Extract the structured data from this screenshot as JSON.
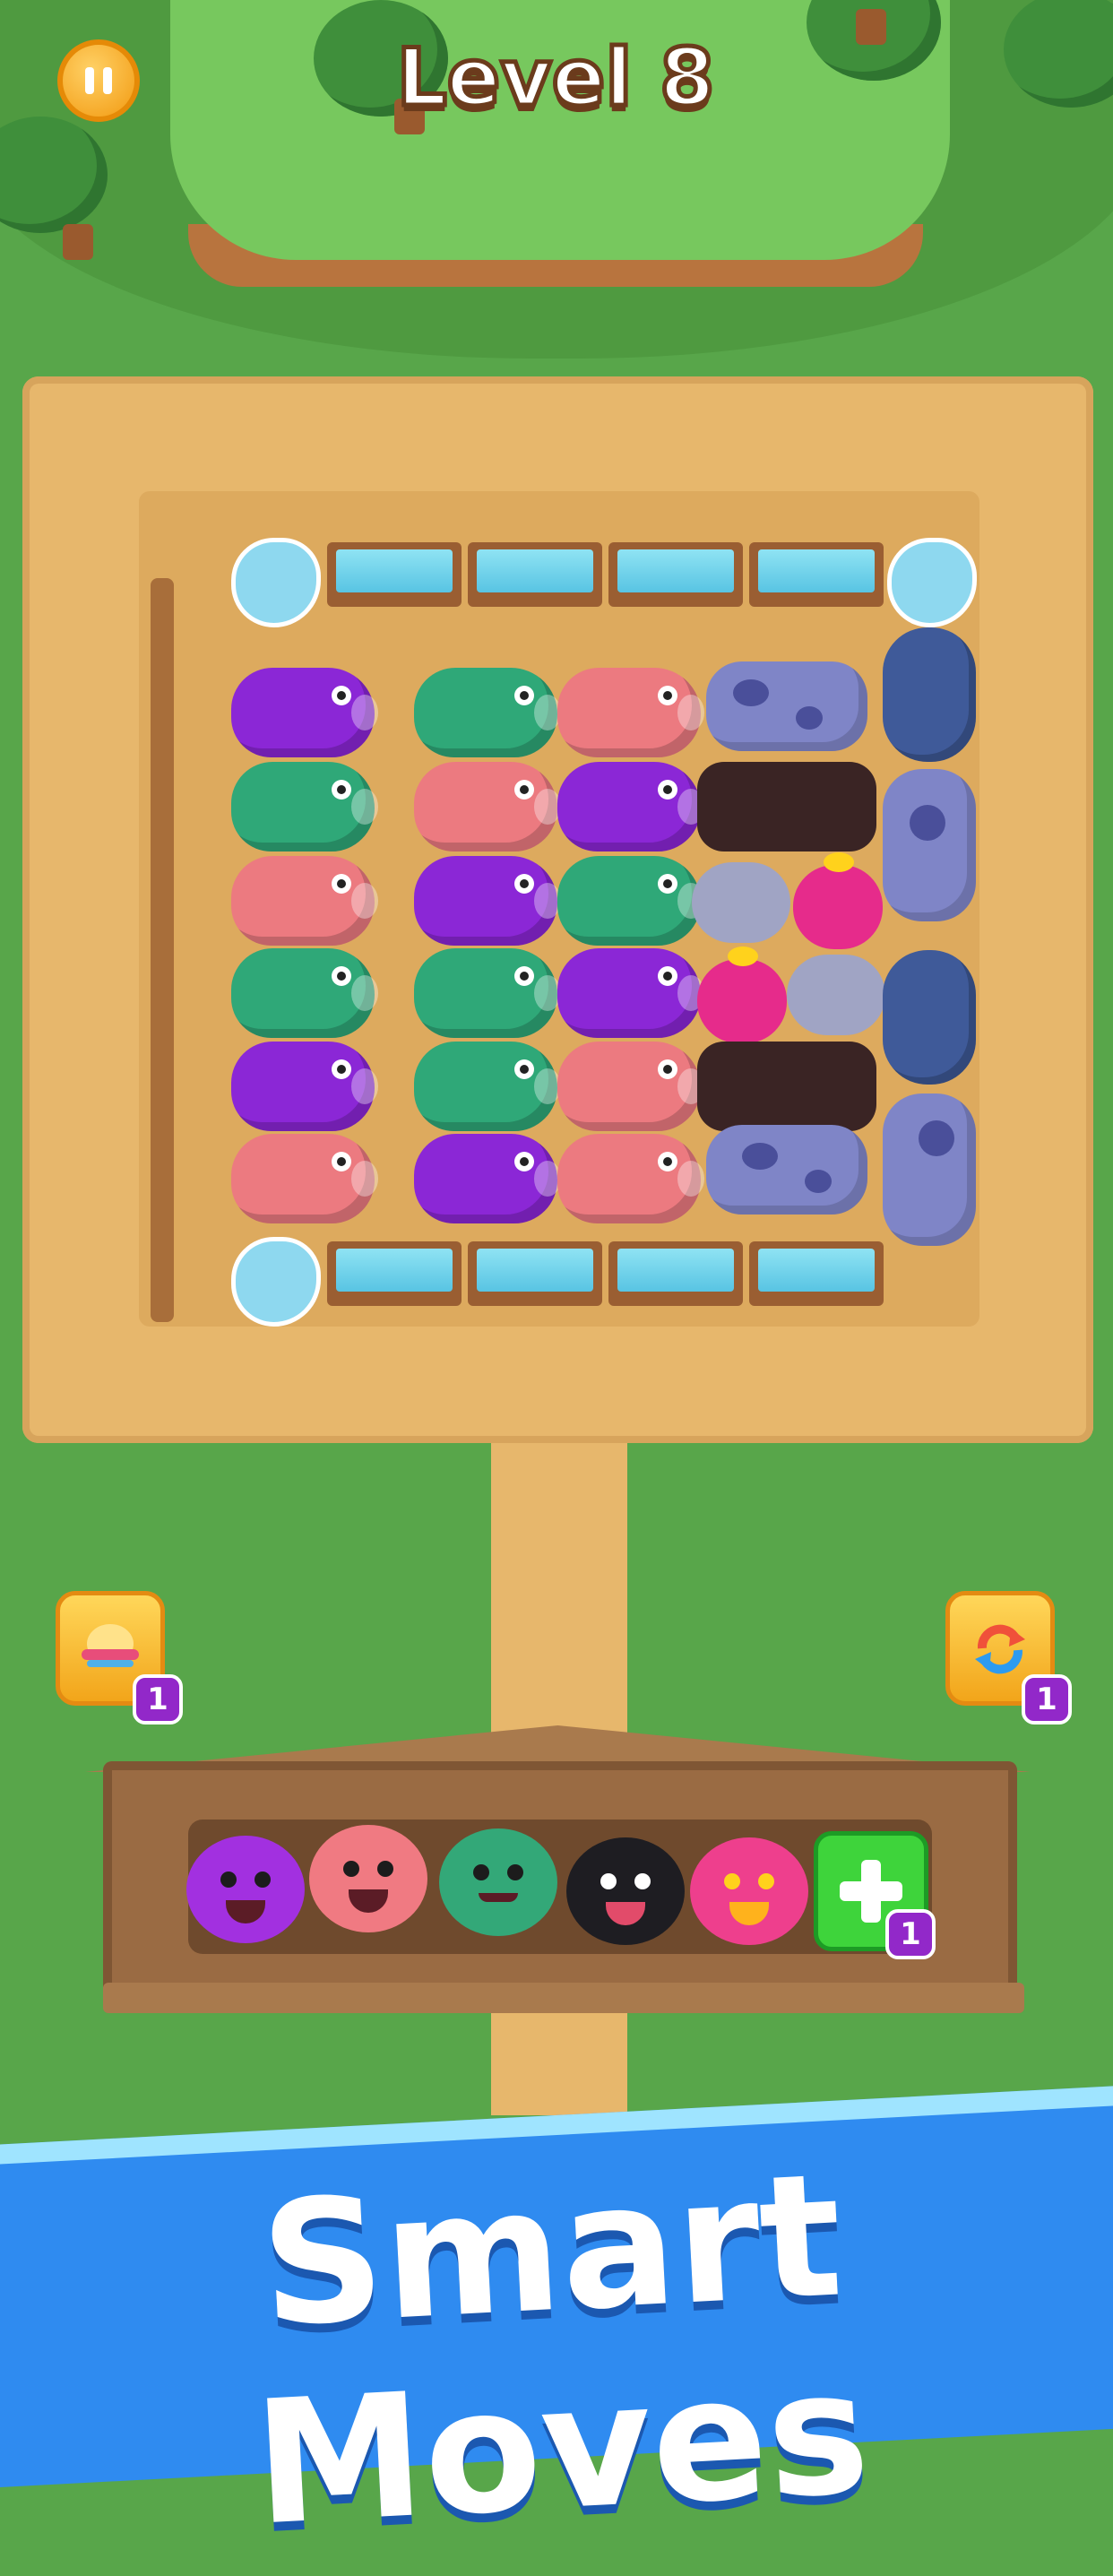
{
  "hud": {
    "level_title": "Level 8"
  },
  "board": {
    "rows": [
      [
        "pig-purple",
        "pig-green",
        "pig-pink",
        "cow"
      ],
      [
        "pig-green",
        "pig-pink",
        "pig-purple",
        "bull"
      ],
      [
        "pig-pink",
        "pig-purple",
        "pig-green",
        "rabbit",
        "chicken"
      ],
      [
        "pig-green",
        "pig-green",
        "pig-purple",
        "chicken",
        "rabbit"
      ],
      [
        "pig-purple",
        "pig-green",
        "pig-pink",
        "bull"
      ],
      [
        "pig-pink",
        "pig-purple",
        "pig-pink",
        "cow"
      ]
    ],
    "right_column": [
      "sheep",
      "cow",
      "sheep",
      "cow"
    ]
  },
  "boosters": {
    "left": {
      "icon": "magnet-hat-icon",
      "count": "1"
    },
    "right": {
      "icon": "shuffle-icon",
      "count": "1"
    }
  },
  "shelf": {
    "slots": [
      "purple-pig",
      "pink-pig",
      "green-pig",
      "black-sheep",
      "pink-chicken"
    ],
    "add_slot_count": "1"
  },
  "banner": {
    "text": "Smart Moves"
  },
  "colors": {
    "grass": "#58a64a",
    "dirt": "#e7b76c",
    "purple": "#8b27d6",
    "green": "#2fa878",
    "pink": "#ec7a80",
    "cow": "#7f85c7",
    "banner": "#2f8bf0"
  }
}
